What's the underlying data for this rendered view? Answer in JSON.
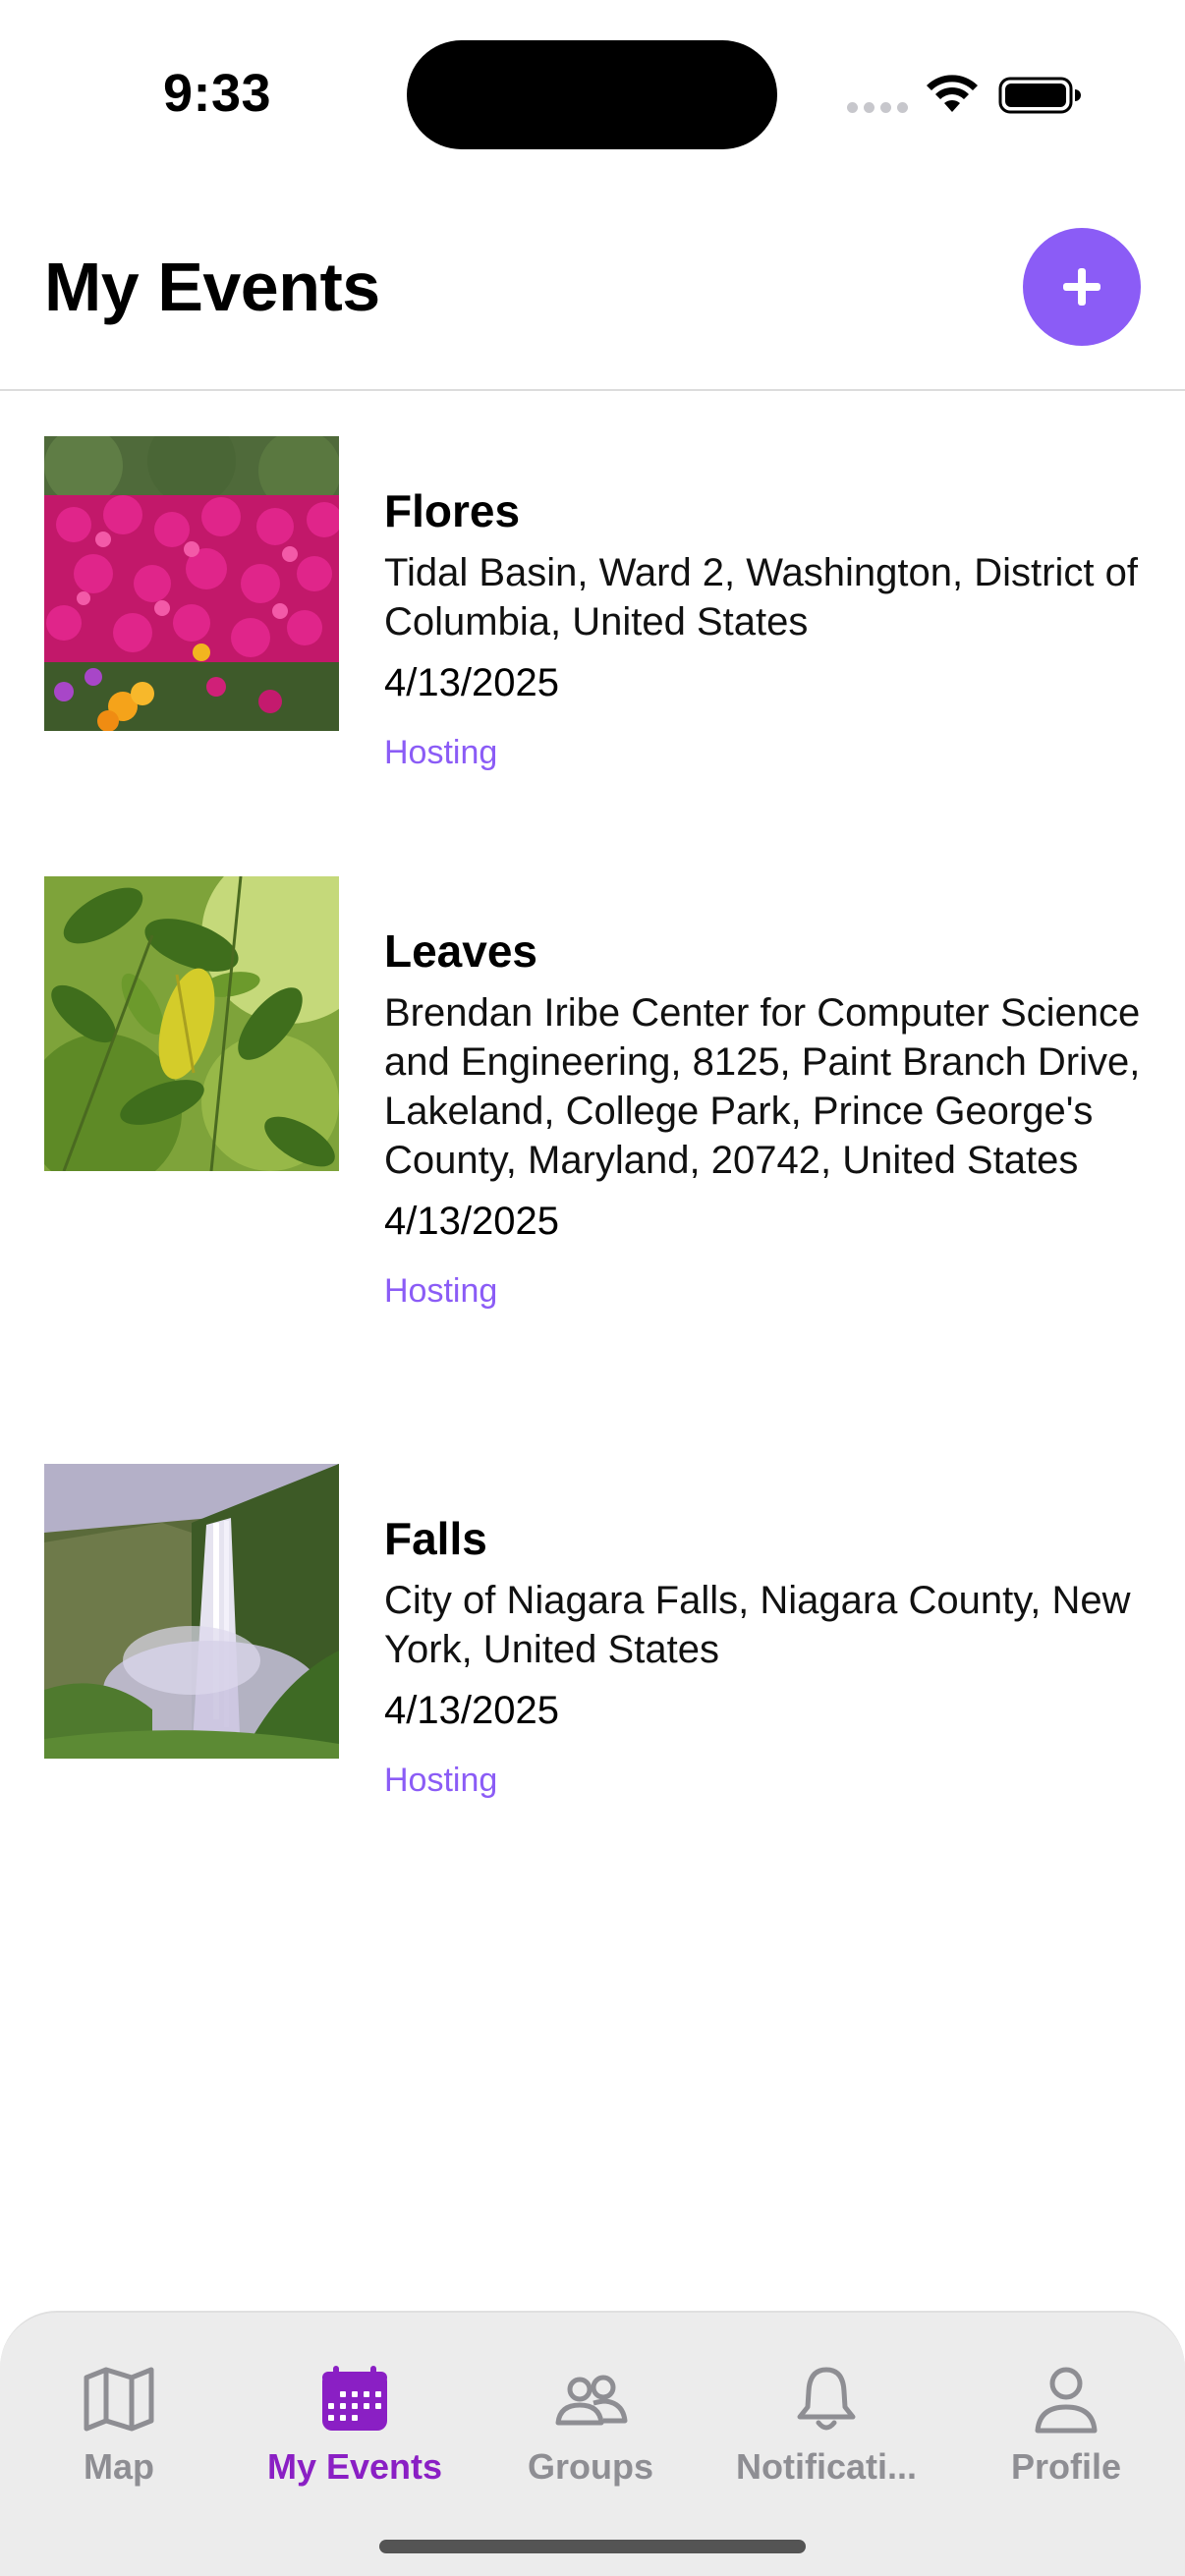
{
  "status_bar": {
    "time": "9:33"
  },
  "header": {
    "title": "My Events",
    "add_button_label": "+"
  },
  "events": [
    {
      "title": "Flores",
      "location": "Tidal Basin, Ward 2, Washington, District of Columbia, United States",
      "date": "4/13/2025",
      "role": "Hosting",
      "image": "flowers"
    },
    {
      "title": "Leaves",
      "location": "Brendan Iribe Center for Computer Science and Engineering, 8125, Paint Branch Drive, Lakeland, College Park, Prince George's County, Maryland, 20742, United States",
      "date": "4/13/2025",
      "role": "Hosting",
      "image": "leaves"
    },
    {
      "title": "Falls",
      "location": "City of Niagara Falls, Niagara County, New York, United States",
      "date": "4/13/2025",
      "role": "Hosting",
      "image": "waterfall"
    }
  ],
  "tab_bar": {
    "tabs": [
      {
        "label": "Map",
        "icon": "map-icon",
        "active": false
      },
      {
        "label": "My Events",
        "icon": "calendar-icon",
        "active": true
      },
      {
        "label": "Groups",
        "icon": "groups-icon",
        "active": false
      },
      {
        "label": "Notificati...",
        "icon": "bell-icon",
        "active": false
      },
      {
        "label": "Profile",
        "icon": "person-icon",
        "active": false
      }
    ]
  },
  "colors": {
    "accent": "#8b5cf6",
    "active_tab": "#8a1fc4",
    "inactive_tab": "#8e8e93"
  }
}
